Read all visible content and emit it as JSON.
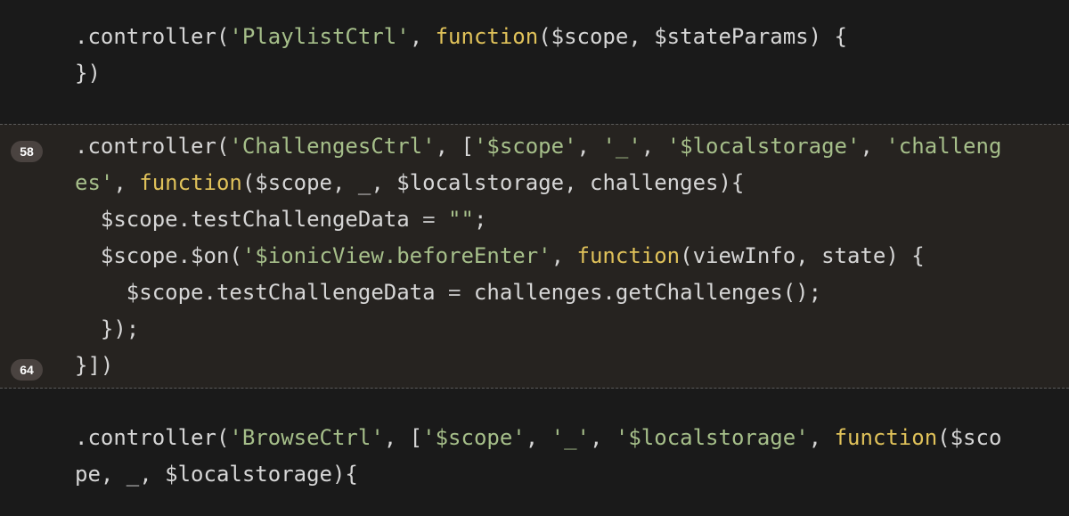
{
  "colors": {
    "background": "#1a1a1a",
    "highlight_background": "#262320",
    "plain": "#d6d6d6",
    "string": "#a6bf8a",
    "keyword": "#e0c25a",
    "badge": "#4a4340"
  },
  "highlight": {
    "start_badge": "58",
    "end_badge": "64"
  },
  "code": {
    "l1": {
      "t1": ".controller(",
      "t2": "'PlaylistCtrl'",
      "t3": ", ",
      "t4": "function",
      "t5": "($scope, $stateParams) {"
    },
    "l2": {
      "t1": "})"
    },
    "l3": {
      "t1": ".controller(",
      "t2": "'ChallengesCtrl'",
      "t3": ", [",
      "t4": "'$scope'",
      "t5": ", ",
      "t6": "'_'",
      "t7": ", ",
      "t8": "'$localstorage'",
      "t9": ", ",
      "t10": "'challeng"
    },
    "l4": {
      "t1": "es'",
      "t2": ", ",
      "t3": "function",
      "t4": "($scope, _, $localstorage, challenges){"
    },
    "l5": {
      "t1": "  $scope.testChallengeData ",
      "t2": "=",
      "t3": " ",
      "t4": "\"\"",
      "t5": ";"
    },
    "l6": {
      "t1": "  $scope.$on(",
      "t2": "'$ionicView.beforeEnter'",
      "t3": ", ",
      "t4": "function",
      "t5": "(viewInfo, state) {"
    },
    "l7": {
      "t1": "    $scope.testChallengeData ",
      "t2": "=",
      "t3": " challenges.getChallenges();"
    },
    "l8": {
      "t1": "  });"
    },
    "l9": {
      "t1": "}])"
    },
    "l10": {
      "t1": ".controller(",
      "t2": "'BrowseCtrl'",
      "t3": ", [",
      "t4": "'$scope'",
      "t5": ", ",
      "t6": "'_'",
      "t7": ", ",
      "t8": "'$localstorage'",
      "t9": ", ",
      "t10": "function",
      "t11": "($sco"
    },
    "l11": {
      "t1": "pe, _, $localstorage){"
    }
  }
}
